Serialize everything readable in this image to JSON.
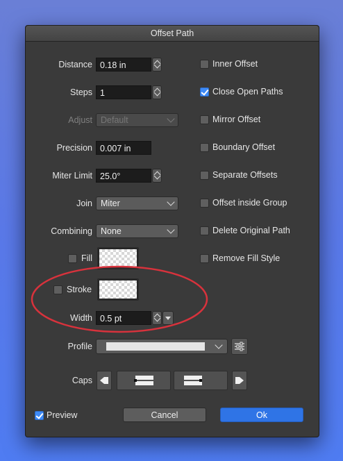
{
  "window": {
    "title": "Offset Path"
  },
  "fields": {
    "distance": {
      "label": "Distance",
      "value": "0.18 in"
    },
    "steps": {
      "label": "Steps",
      "value": "1"
    },
    "adjust": {
      "label": "Adjust",
      "value": "Default"
    },
    "precision": {
      "label": "Precision",
      "value": "0.007 in"
    },
    "miter_limit": {
      "label": "Miter Limit",
      "value": "25.0°"
    },
    "join": {
      "label": "Join",
      "value": "Miter"
    },
    "combining": {
      "label": "Combining",
      "value": "None"
    },
    "fill": {
      "label": "Fill",
      "checked": false
    },
    "stroke": {
      "label": "Stroke",
      "checked": false
    },
    "width": {
      "label": "Width",
      "value": "0.5 pt"
    },
    "profile": {
      "label": "Profile"
    },
    "caps": {
      "label": "Caps"
    }
  },
  "options": [
    {
      "label": "Inner Offset",
      "checked": false
    },
    {
      "label": "Close Open Paths",
      "checked": true
    },
    {
      "label": "Mirror Offset",
      "checked": false
    },
    {
      "label": "Boundary Offset",
      "checked": false
    },
    {
      "label": "Separate Offsets",
      "checked": false
    },
    {
      "label": "Offset inside Group",
      "checked": false
    },
    {
      "label": "Delete Original Path",
      "checked": false
    },
    {
      "label": "Remove Fill Style",
      "checked": false
    }
  ],
  "footer": {
    "preview": {
      "label": "Preview",
      "checked": true
    },
    "cancel_label": "Cancel",
    "ok_label": "Ok"
  },
  "colors": {
    "background_gradient_top": "#6a7fd6",
    "background_gradient_bottom": "#4f7cf2",
    "dialog_bg": "#3a3a3a",
    "accent": "#2f74e6",
    "annotation_circle": "#d8323c"
  },
  "icons": {
    "stepper": "up-down-chevron-icon",
    "dropdown": "chevron-down-icon",
    "profile_settings": "sliders-icon",
    "cap_left": "arrow-left-icon",
    "cap_right": "arrow-right-icon"
  }
}
